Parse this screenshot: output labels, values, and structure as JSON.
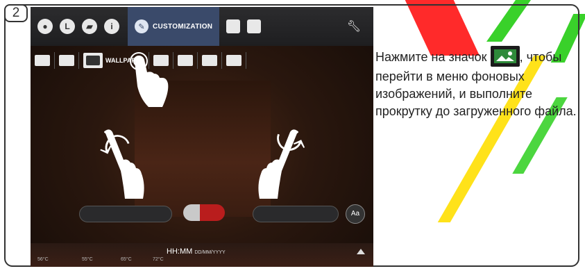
{
  "step": {
    "number": "2"
  },
  "nav": {
    "active_label": "CUSTOMIZATION"
  },
  "subbar": {
    "active_label": "WALLPAPER"
  },
  "status": {
    "time": "HH:MM",
    "date": "DD/MM/YYYY",
    "temps": [
      "56°C",
      "55°C",
      "65°C",
      "72°C"
    ]
  },
  "font_button": {
    "label": "Aa"
  },
  "instruction": {
    "part1": "Нажмите на значок",
    "part2": ", чтобы перейти в меню фоновых изображений, и выполните прокрутку до загруженного файла."
  },
  "colors": {
    "accent_nav": "#3a4a6a",
    "screen_bg": "#1b110c",
    "panel": "#4a2516"
  },
  "icons": [
    "drop-icon",
    "clock-icon",
    "flag-icon",
    "info-icon",
    "pencil-icon",
    "keyboard-icon",
    "person-icon",
    "wrench-icon",
    "book-icon",
    "wallpaper-icon",
    "screen-icon",
    "speaker-icon",
    "usb-icon",
    "palette-icon",
    "hand-icon",
    "arrow-icon"
  ]
}
